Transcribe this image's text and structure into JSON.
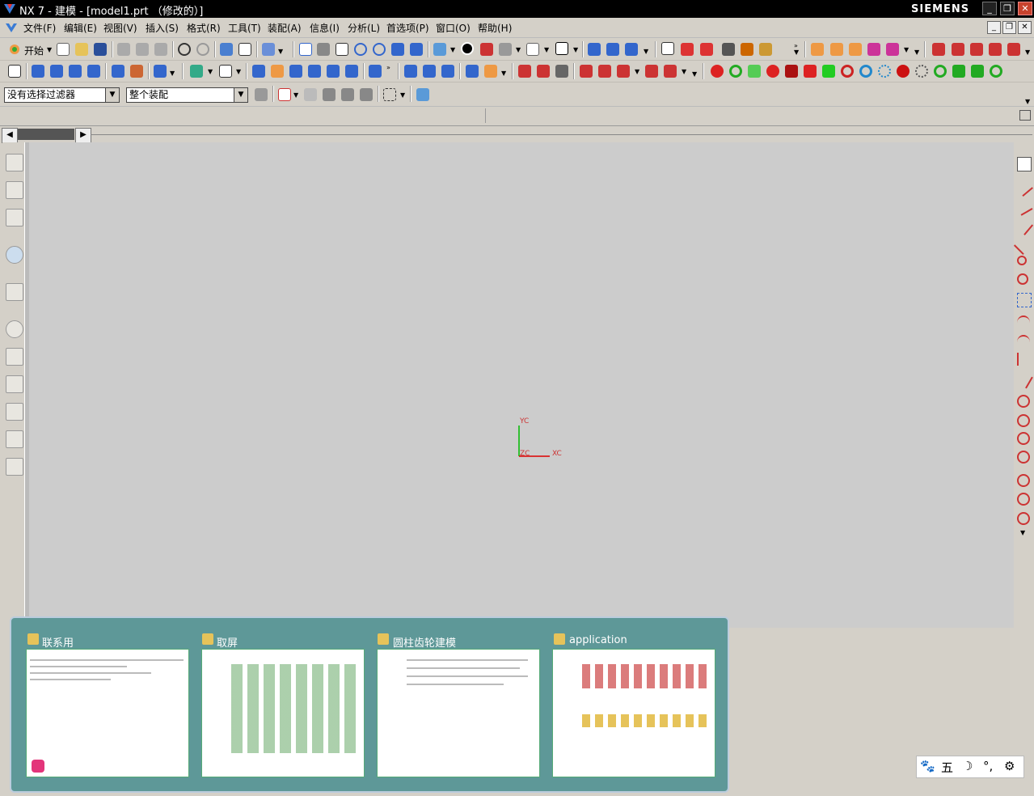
{
  "window": {
    "title": "NX 7 - 建模 - [model1.prt （修改的）]",
    "brand": "SIEMENS",
    "colors": {
      "titlebar": "#000000",
      "close": "#c8432d"
    }
  },
  "menu": {
    "items": [
      {
        "name": "menu-file",
        "label": "文件(F)"
      },
      {
        "name": "menu-edit",
        "label": "编辑(E)"
      },
      {
        "name": "menu-view",
        "label": "视图(V)"
      },
      {
        "name": "menu-insert",
        "label": "插入(S)"
      },
      {
        "name": "menu-format",
        "label": "格式(R)"
      },
      {
        "name": "menu-tools",
        "label": "工具(T)"
      },
      {
        "name": "menu-assembly",
        "label": "装配(A)"
      },
      {
        "name": "menu-info",
        "label": "信息(I)"
      },
      {
        "name": "menu-analysis",
        "label": "分析(L)"
      },
      {
        "name": "menu-preferences",
        "label": "首选项(P)"
      },
      {
        "name": "menu-window",
        "label": "窗口(O)"
      },
      {
        "name": "menu-help",
        "label": "帮助(H)"
      }
    ]
  },
  "toolbar": {
    "start_label": "开始"
  },
  "filters": {
    "selection_filter": "没有选择过滤器",
    "assembly_scope": "整个装配"
  },
  "axes": {
    "yc": "YC",
    "xc": "XC",
    "zc": "ZC",
    "colors": {
      "x": "#dd0000",
      "y": "#00bb00"
    }
  },
  "taskbar_preview": {
    "windows": [
      {
        "label": "联系用"
      },
      {
        "label": "取屏"
      },
      {
        "label": "圆柱齿轮建模"
      },
      {
        "label": "application"
      }
    ]
  },
  "tray": {
    "ime_label": "五"
  }
}
